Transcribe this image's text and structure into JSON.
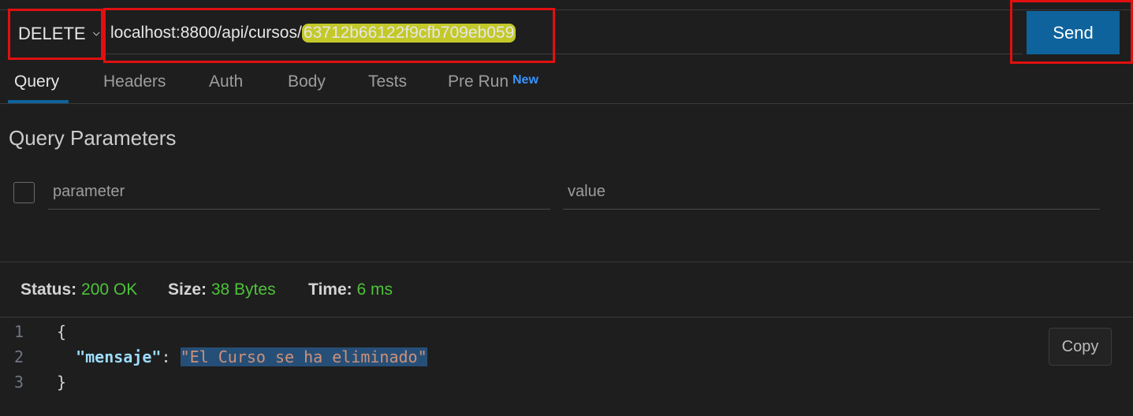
{
  "request": {
    "method": "DELETE",
    "url_prefix": "localhost:8800/api/cursos/",
    "url_id": "63712b66122f9cfb709eb059",
    "send_label": "Send"
  },
  "tabs": {
    "query": "Query",
    "headers": "Headers",
    "auth": "Auth",
    "body": "Body",
    "tests": "Tests",
    "prerun": "Pre Run",
    "prerun_badge": "New"
  },
  "query_section": {
    "title": "Query Parameters",
    "parameter_placeholder": "parameter",
    "value_placeholder": "value"
  },
  "response": {
    "status_label": "Status:",
    "status_value": "200 OK",
    "size_label": "Size:",
    "size_value": "38 Bytes",
    "time_label": "Time:",
    "time_value": "6 ms",
    "copy_label": "Copy",
    "lines": [
      {
        "num": "1",
        "open": "{"
      },
      {
        "num": "2",
        "key": "\"mensaje\"",
        "sep": ": ",
        "value": "\"El Curso se ha eliminado\""
      },
      {
        "num": "3",
        "close": "}"
      }
    ]
  },
  "colors": {
    "accent": "#0e639c",
    "ok_green": "#4ec23a",
    "annotation_red": "#e01010",
    "highlight_yellow": "#c4c92a"
  }
}
